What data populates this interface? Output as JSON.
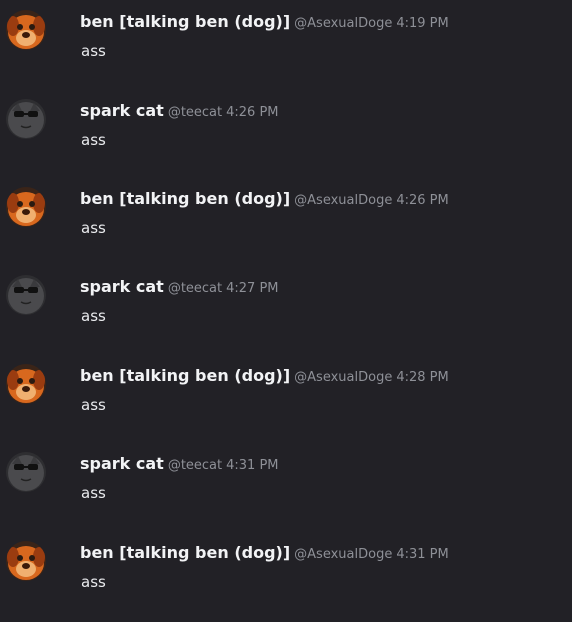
{
  "messages": [
    {
      "author": "ben [talking ben (dog)]",
      "handle": "@AsexualDoge",
      "time": "4:19 PM",
      "text": "ass",
      "avatar": "dog"
    },
    {
      "author": "spark cat",
      "handle": "@teecat",
      "time": "4:26 PM",
      "text": "ass",
      "avatar": "cat"
    },
    {
      "author": "ben [talking ben (dog)]",
      "handle": "@AsexualDoge",
      "time": "4:26 PM",
      "text": "ass",
      "avatar": "dog"
    },
    {
      "author": "spark cat",
      "handle": "@teecat",
      "time": "4:27 PM",
      "text": "ass",
      "avatar": "cat"
    },
    {
      "author": "ben [talking ben (dog)]",
      "handle": "@AsexualDoge",
      "time": "4:28 PM",
      "text": "ass",
      "avatar": "dog"
    },
    {
      "author": "spark cat",
      "handle": "@teecat",
      "time": "4:31 PM",
      "text": "ass",
      "avatar": "cat"
    },
    {
      "author": "ben [talking ben (dog)]",
      "handle": "@AsexualDoge",
      "time": "4:31 PM",
      "text": "ass",
      "avatar": "dog"
    }
  ],
  "colors": {
    "background": "#222126",
    "username": "#f2f3f5",
    "meta": "#8e9097",
    "message_text": "#e9eaed",
    "dog_avatar": "#d8681e",
    "cat_avatar": "#4a4a4d"
  }
}
